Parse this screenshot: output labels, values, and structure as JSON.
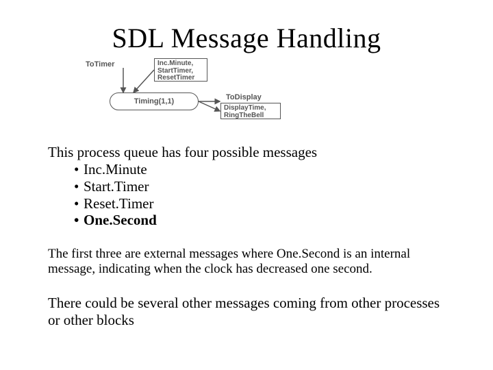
{
  "title": "SDL Message Handling",
  "diagram": {
    "to_timer_label": "ToTimer",
    "incoming_messages": "Inc.Minute,\nStartTimer,\nResetTimer",
    "process_label": "Timing(1,1)",
    "to_display_label": "ToDisplay",
    "outgoing_messages": "DisplayTime,\nRingTheBell"
  },
  "intro_line": "This process queue has four possible messages",
  "bullets": [
    {
      "text": "Inc.Minute",
      "bold": false
    },
    {
      "text": "Start.Timer",
      "bold": false
    },
    {
      "text": "Reset.Timer",
      "bold": false
    },
    {
      "text": "One.Second",
      "bold": true
    }
  ],
  "paragraph1": "The first three are external messages where One.Second is an internal message, indicating when the clock has decreased one second.",
  "paragraph2": "There could be several other messages coming from other processes or other blocks"
}
